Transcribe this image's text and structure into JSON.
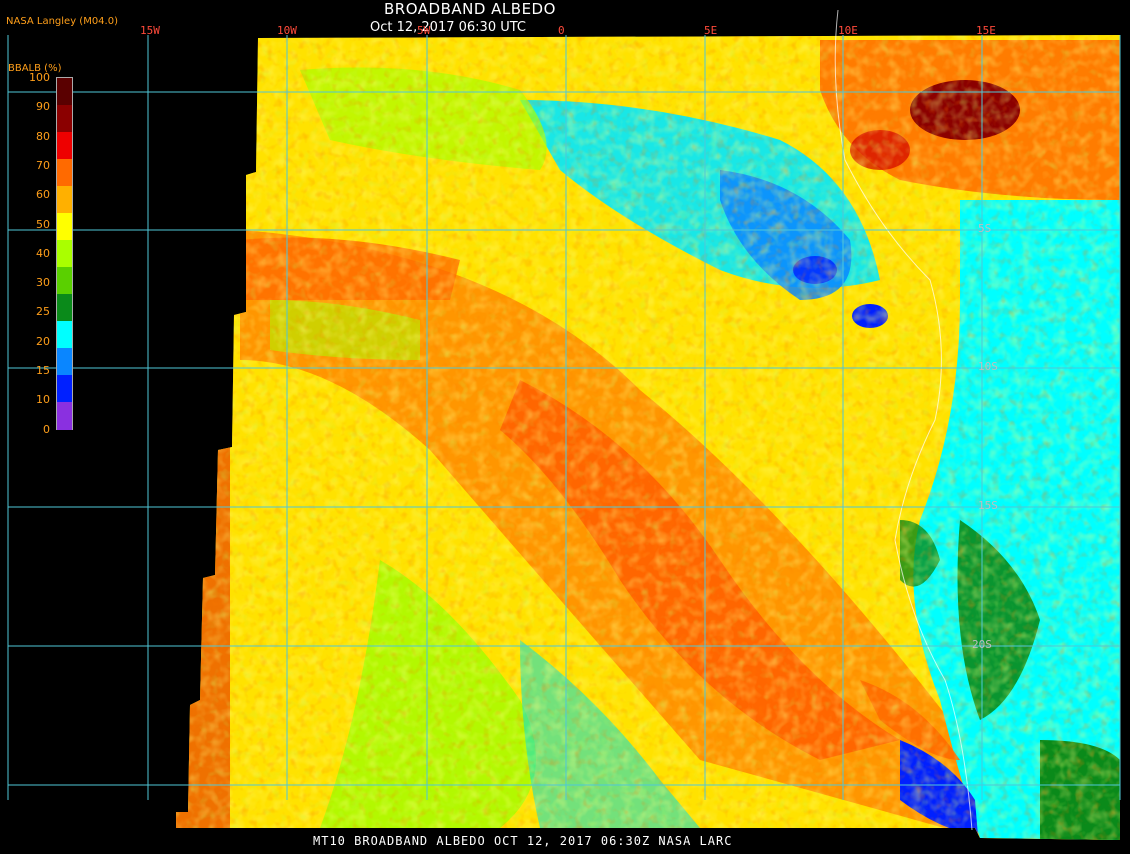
{
  "header": {
    "title": "BROADBAND ALBEDO",
    "subtitle": "Oct 12, 2017 06:30 UTC",
    "producer": "NASA Langley (M04.0)"
  },
  "legend": {
    "title": "BBALB (%)",
    "ticks": [
      "100",
      "90",
      "80",
      "70",
      "60",
      "50",
      "40",
      "30",
      "25",
      "20",
      "15",
      "10",
      "0"
    ],
    "colors": [
      "#5a0000",
      "#8b0000",
      "#ee0000",
      "#ff6a00",
      "#ffb000",
      "#ffff00",
      "#aaff00",
      "#5ad000",
      "#0a8a1a",
      "#00ffff",
      "#0a86ff",
      "#0020ff",
      "#8a30e0"
    ]
  },
  "graticule": {
    "longitude_labels": [
      "15W",
      "10W",
      "5W",
      "0",
      "5E",
      "10E",
      "15E"
    ],
    "latitude_labels": [
      "5S",
      "10S",
      "15S",
      "20S"
    ],
    "line_color": "#4fc7d8"
  },
  "footer": {
    "text": "MT10  BROADBAND ALBEDO   OCT 12, 2017 06:30Z   NASA LARC"
  }
}
